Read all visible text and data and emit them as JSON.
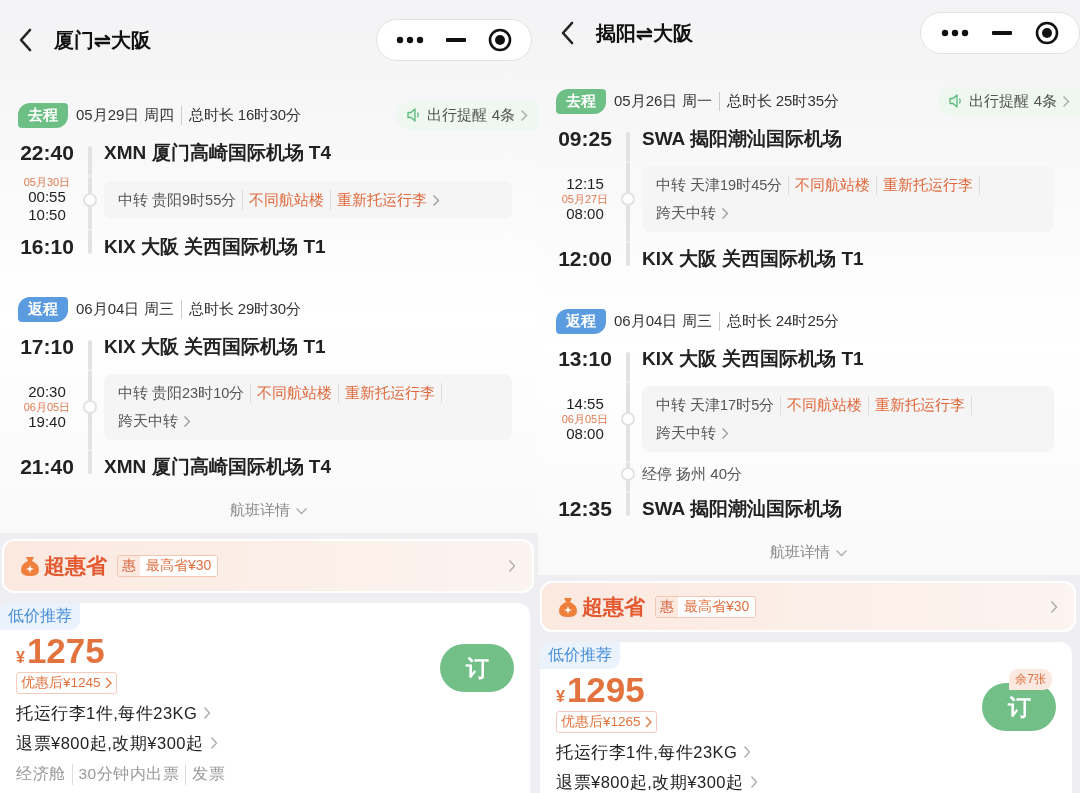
{
  "panels": [
    {
      "title": "厦门⇌大阪",
      "trips": [
        {
          "kind": "outbound",
          "tag": "去程",
          "date": "05月29日 周四",
          "duration": "总时长 16时30分",
          "reminder": "出行提醒 4条",
          "segments": [
            {
              "kind": "airport",
              "time": "22:40",
              "airport": "XMN 厦门高崎国际机场 T4"
            },
            {
              "kind": "transfer",
              "times": [
                {
                  "kind": "date",
                  "text": "05月30日"
                },
                {
                  "kind": "time",
                  "text": "00:55"
                },
                {
                  "kind": "time",
                  "text": "10:50"
                }
              ],
              "lines": [
                [
                  {
                    "kind": "info",
                    "text": "中转 贵阳9时55分"
                  },
                  {
                    "kind": "warning",
                    "text": "不同航站楼"
                  },
                  {
                    "kind": "warning",
                    "text": "重新托运行李"
                  }
                ]
              ]
            },
            {
              "kind": "airport",
              "time": "16:10",
              "airport": "KIX 大阪 关西国际机场 T1"
            }
          ]
        },
        {
          "kind": "return",
          "tag": "返程",
          "date": "06月04日 周三",
          "duration": "总时长 29时30分",
          "segments": [
            {
              "kind": "airport",
              "time": "17:10",
              "airport": "KIX 大阪 关西国际机场 T1"
            },
            {
              "kind": "transfer",
              "times": [
                {
                  "kind": "time",
                  "text": "20:30"
                },
                {
                  "kind": "date",
                  "text": "06月05日"
                },
                {
                  "kind": "time",
                  "text": "19:40"
                }
              ],
              "lines": [
                [
                  {
                    "kind": "info",
                    "text": "中转 贵阳23时10分"
                  },
                  {
                    "kind": "warning",
                    "text": "不同航站楼"
                  },
                  {
                    "kind": "warning",
                    "text": "重新托运行李"
                  }
                ],
                [
                  {
                    "kind": "info",
                    "text": "跨天中转"
                  }
                ]
              ]
            },
            {
              "kind": "airport",
              "time": "21:40",
              "airport": "XMN 厦门高崎国际机场 T4"
            }
          ]
        }
      ],
      "details": "航班详情",
      "promo": {
        "brand": "超惠省",
        "badge": "惠",
        "text": "最高省¥30"
      },
      "offer": {
        "tag": "低价推荐",
        "currency": "¥",
        "price": "1275",
        "discount": "优惠后¥1245",
        "button": "订",
        "lines": [
          "托运行李1件,每件23KG",
          "退票¥800起,改期¥300起"
        ],
        "footer": [
          "经济舱",
          "30分钟内出票",
          "发票"
        ]
      }
    },
    {
      "title": "揭阳⇌大阪",
      "trips": [
        {
          "kind": "outbound",
          "tag": "去程",
          "date": "05月26日 周一",
          "duration": "总时长 25时35分",
          "reminder": "出行提醒 4条",
          "segments": [
            {
              "kind": "airport",
              "time": "09:25",
              "airport": "SWA 揭阳潮汕国际机场"
            },
            {
              "kind": "transfer",
              "times": [
                {
                  "kind": "time",
                  "text": "12:15"
                },
                {
                  "kind": "date",
                  "text": "05月27日"
                },
                {
                  "kind": "time",
                  "text": "08:00"
                }
              ],
              "lines": [
                [
                  {
                    "kind": "info",
                    "text": "中转 天津19时45分"
                  },
                  {
                    "kind": "warning",
                    "text": "不同航站楼"
                  },
                  {
                    "kind": "warning",
                    "text": "重新托运行李"
                  }
                ],
                [
                  {
                    "kind": "info",
                    "text": "跨天中转"
                  }
                ]
              ]
            },
            {
              "kind": "airport",
              "time": "12:00",
              "airport": "KIX 大阪 关西国际机场 T1"
            }
          ]
        },
        {
          "kind": "return",
          "tag": "返程",
          "date": "06月04日 周三",
          "duration": "总时长 24时25分",
          "segments": [
            {
              "kind": "airport",
              "time": "13:10",
              "airport": "KIX 大阪 关西国际机场 T1"
            },
            {
              "kind": "transfer",
              "times": [
                {
                  "kind": "time",
                  "text": "14:55"
                },
                {
                  "kind": "date",
                  "text": "06月05日"
                },
                {
                  "kind": "time",
                  "text": "08:00"
                }
              ],
              "lines": [
                [
                  {
                    "kind": "info",
                    "text": "中转 天津17时5分"
                  },
                  {
                    "kind": "warning",
                    "text": "不同航站楼"
                  },
                  {
                    "kind": "warning",
                    "text": "重新托运行李"
                  }
                ],
                [
                  {
                    "kind": "info",
                    "text": "跨天中转"
                  }
                ]
              ]
            },
            {
              "kind": "stop",
              "text": "经停 扬州 40分"
            },
            {
              "kind": "airport",
              "time": "12:35",
              "airport": "SWA 揭阳潮汕国际机场"
            }
          ]
        }
      ],
      "details": "航班详情",
      "promo": {
        "brand": "超惠省",
        "badge": "惠",
        "text": "最高省¥30"
      },
      "offer": {
        "tag": "低价推荐",
        "currency": "¥",
        "price": "1295",
        "discount": "优惠后¥1265",
        "remaining": "余7张",
        "button": "订",
        "lines": [
          "托运行李1件,每件23KG",
          "退票¥800起,改期¥300起"
        ]
      }
    }
  ]
}
